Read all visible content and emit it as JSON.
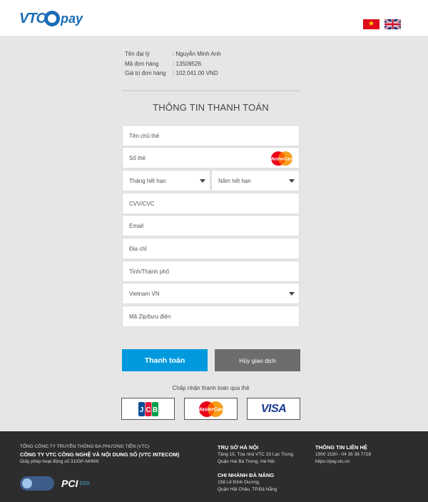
{
  "header": {
    "logo_left": "VTC",
    "logo_right": "pay",
    "languages": [
      "vi",
      "en"
    ]
  },
  "order": {
    "agent_label": "Tên đại lý",
    "agent_value": ": Nguyễn Minh Anh",
    "order_label": "Mã đơn hàng",
    "order_value": ": 13509526",
    "amount_label": "Giá trị đơn hàng",
    "amount_value": ": 102.041.00  VND"
  },
  "form": {
    "title": "THÔNG TIN THANH TOÁN",
    "cardholder_placeholder": "Tên chủ thẻ",
    "card_number_placeholder": "Số thẻ",
    "exp_month_placeholder": "Tháng hết hạn",
    "exp_year_placeholder": "Năm hết hạn",
    "cvv_placeholder": "CVV/CVC",
    "email_placeholder": "Email",
    "address_placeholder": "Địa chỉ",
    "city_placeholder": "Tỉnh/Thành phố",
    "country_value": "Vietnam VN",
    "zip_placeholder": "Mã Zip/bưu điện"
  },
  "actions": {
    "pay_label": "Thanh toán",
    "cancel_label": "Hủy giao dịch"
  },
  "accepted": {
    "label": "Chấp nhận thanh toán qua thẻ",
    "cards": [
      "JCB",
      "MasterCard",
      "VISA"
    ]
  },
  "footer": {
    "company_line1": "TỔNG CÔNG TY TRUYỀN THÔNG ĐA PHƯƠNG TIỆN (VTC)",
    "company_line2": "CÔNG TY VTC CÔNG NGHỆ VÀ NỘI DUNG SỐ (VTC INTECOM)",
    "license": "Giấy phép hoạt động số 31/GP-NHNN",
    "hq_title": "TRỤ SỞ HÀ NỘI",
    "hq_line1": "Tầng 15, Tòa nhà VTC 23 Lạc Trung,",
    "hq_line2": "Quận Hai Bà Trưng, Hà Nội",
    "branch_title": "CHI NHÁNH ĐÀ NẴNG",
    "branch_line1": "158 Lê Đình Dương,",
    "branch_line2": "Quận Hải Châu, TP.Đà Nẵng",
    "contact_title": "THÔNG TIN LIÊN HỆ",
    "contact_phone": "1900 1530 - 04 36 36 7728",
    "contact_url": "https://pay.vtc.vn",
    "pci_text": "PCI",
    "pci_dss": "DSS"
  },
  "colors": {
    "brand_blue": "#1b6cb5",
    "pay_button": "#0099dd",
    "cancel_button": "#6d6d6d",
    "footer_bg": "#2d2d2d",
    "page_bg": "#e6e6e6"
  }
}
